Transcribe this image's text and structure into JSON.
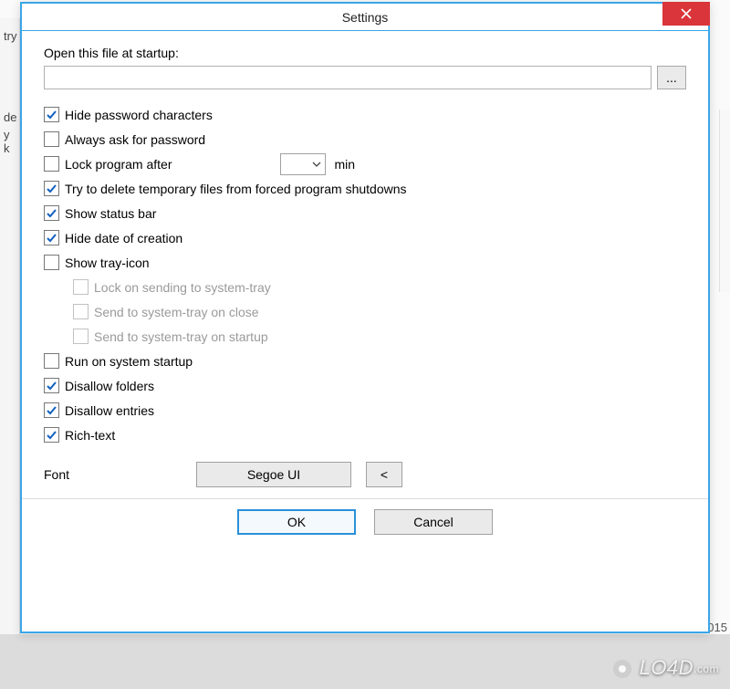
{
  "dialog": {
    "title": "Settings",
    "open_file_label": "Open this file at startup:",
    "open_file_value": "",
    "browse_label": "...",
    "options": [
      {
        "key": "hide_pw",
        "label": "Hide password characters",
        "checked": true,
        "disabled": false,
        "indented": false
      },
      {
        "key": "ask_pw",
        "label": "Always ask for password",
        "checked": false,
        "disabled": false,
        "indented": false
      },
      {
        "key": "lock_after",
        "label": "Lock program after",
        "checked": false,
        "disabled": false,
        "indented": false,
        "has_combo": true
      },
      {
        "key": "del_tmp",
        "label": "Try to delete temporary files from forced program shutdowns",
        "checked": true,
        "disabled": false,
        "indented": false
      },
      {
        "key": "status_bar",
        "label": "Show status bar",
        "checked": true,
        "disabled": false,
        "indented": false
      },
      {
        "key": "hide_date",
        "label": "Hide date of creation",
        "checked": true,
        "disabled": false,
        "indented": false
      },
      {
        "key": "tray_icon",
        "label": "Show tray-icon",
        "checked": false,
        "disabled": false,
        "indented": false
      },
      {
        "key": "lock_tray",
        "label": "Lock on sending to system-tray",
        "checked": false,
        "disabled": true,
        "indented": true
      },
      {
        "key": "tray_close",
        "label": "Send to system-tray on close",
        "checked": false,
        "disabled": true,
        "indented": true
      },
      {
        "key": "tray_startup",
        "label": "Send to system-tray on startup",
        "checked": false,
        "disabled": true,
        "indented": true
      },
      {
        "key": "run_startup",
        "label": "Run on system startup",
        "checked": false,
        "disabled": false,
        "indented": false
      },
      {
        "key": "dis_folders",
        "label": "Disallow folders",
        "checked": true,
        "disabled": false,
        "indented": false
      },
      {
        "key": "dis_entries",
        "label": "Disallow entries",
        "checked": true,
        "disabled": false,
        "indented": false
      },
      {
        "key": "richtext",
        "label": "Rich-text",
        "checked": true,
        "disabled": false,
        "indented": false
      }
    ],
    "lock_combo_value": "",
    "lock_suffix": "min",
    "font_label": "Font",
    "font_value": "Segoe UI",
    "font_reset": "<",
    "ok": "OK",
    "cancel": "Cancel"
  },
  "background": {
    "sidebar_fragments": [
      "try",
      "de",
      "y k"
    ],
    "year_fragment": "015"
  },
  "watermark": {
    "brand": "LO4D",
    "suffix": ".com"
  }
}
